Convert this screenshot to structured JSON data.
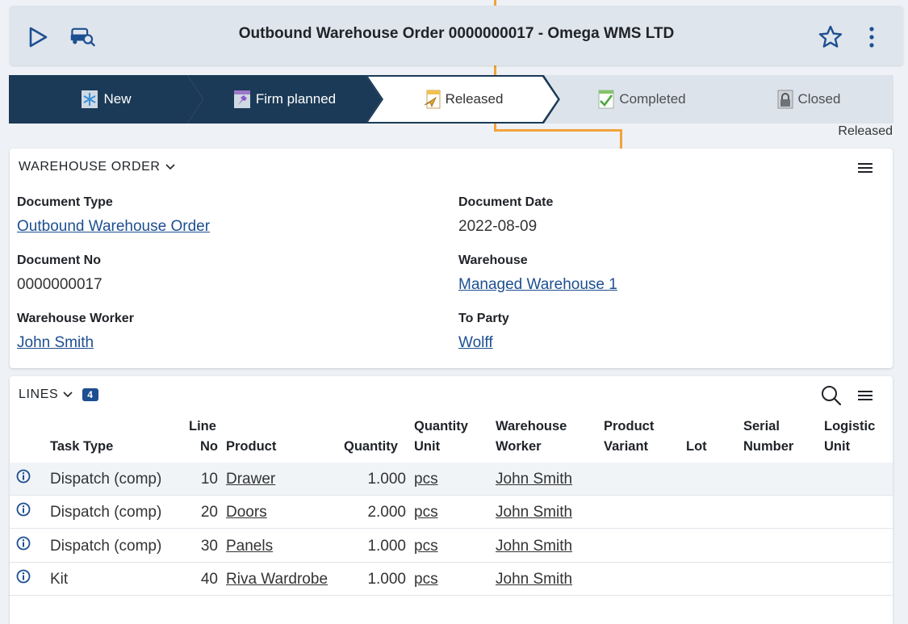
{
  "header": {
    "title": "Outbound Warehouse Order 0000000017 - Omega WMS LTD",
    "play_icon": "play-icon",
    "inspect_icon": "car-search-icon",
    "star_icon": "star-icon",
    "more_icon": "more-vertical-icon"
  },
  "path": {
    "steps": [
      {
        "label": "New",
        "state": "done",
        "icon": "snowflake-icon"
      },
      {
        "label": "Firm planned",
        "state": "done",
        "icon": "pushpin-icon"
      },
      {
        "label": "Released",
        "state": "current",
        "icon": "paper-plane-icon"
      },
      {
        "label": "Completed",
        "state": "todo",
        "icon": "check-icon"
      },
      {
        "label": "Closed",
        "state": "todo",
        "icon": "lock-icon"
      }
    ],
    "status_caption": "Released"
  },
  "order": {
    "title": "WAREHOUSE ORDER",
    "fields": {
      "doc_type_label": "Document Type",
      "doc_type_value": "Outbound Warehouse Order",
      "doc_date_label": "Document Date",
      "doc_date_value": "2022-08-09",
      "doc_no_label": "Document No",
      "doc_no_value": "0000000017",
      "warehouse_label": "Warehouse",
      "warehouse_value": "Managed Warehouse 1",
      "worker_label": "Warehouse Worker",
      "worker_value": "John Smith",
      "party_label": "To Party",
      "party_value": "Wolff"
    }
  },
  "lines": {
    "title": "LINES",
    "count": "4",
    "columns": {
      "task_type": "Task Type",
      "line_no_1": "Line",
      "line_no_2": "No",
      "product": "Product",
      "quantity": "Quantity",
      "qty_unit_1": "Quantity",
      "qty_unit_2": "Unit",
      "worker_1": "Warehouse",
      "worker_2": "Worker",
      "variant_1": "Product",
      "variant_2": "Variant",
      "lot": "Lot",
      "serial_1": "Serial",
      "serial_2": "Number",
      "logistic_1": "Logistic",
      "logistic_2": "Unit"
    },
    "rows": [
      {
        "task_type": "Dispatch (comp)",
        "line_no": "10",
        "product": "Drawer",
        "quantity": "1.000",
        "unit": "pcs",
        "worker": "John Smith"
      },
      {
        "task_type": "Dispatch (comp)",
        "line_no": "20",
        "product": "Doors",
        "quantity": "2.000",
        "unit": "pcs",
        "worker": "John Smith"
      },
      {
        "task_type": "Dispatch (comp)",
        "line_no": "30",
        "product": "Panels",
        "quantity": "1.000",
        "unit": "pcs",
        "worker": "John Smith"
      },
      {
        "task_type": "Kit",
        "line_no": "40",
        "product": "Riva Wardrobe",
        "quantity": "1.000",
        "unit": "pcs",
        "worker": "John Smith"
      }
    ]
  },
  "colors": {
    "accent": "#1d4f91",
    "path_done": "#1b3a57",
    "path_todo": "#dde3ea",
    "deco_line": "#f2a33a"
  }
}
